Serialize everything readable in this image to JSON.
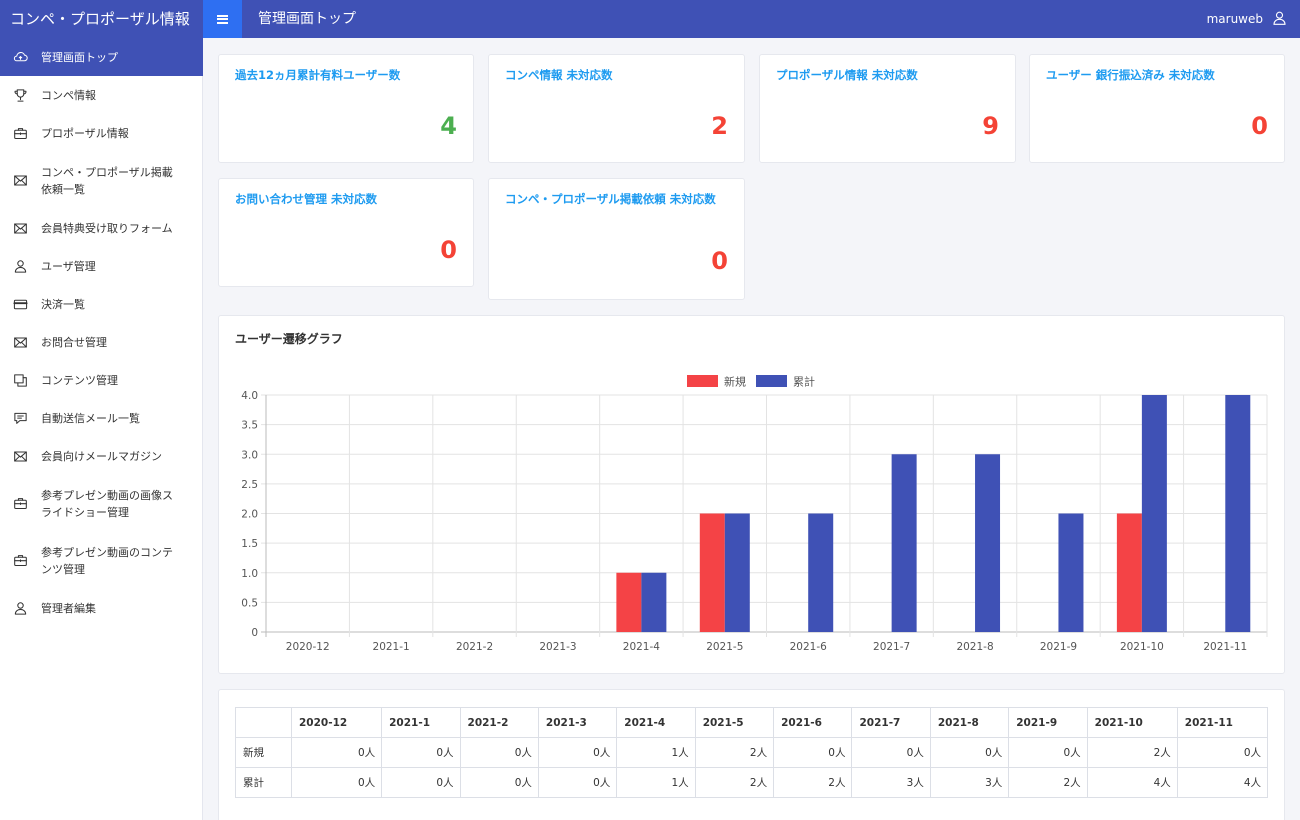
{
  "header": {
    "app_title": "コンペ・プロポーザル情報",
    "page_title": "管理画面トップ",
    "username": "maruweb"
  },
  "sidebar": {
    "items": [
      {
        "label": "管理画面トップ",
        "icon": "cloud-icon",
        "active": true
      },
      {
        "label": "コンペ情報",
        "icon": "trophy-icon"
      },
      {
        "label": "プロポーザル情報",
        "icon": "briefcase-icon"
      },
      {
        "label": "コンペ・プロポーザル掲載依頼一覧",
        "icon": "envelope-icon"
      },
      {
        "label": "会員特典受け取りフォーム",
        "icon": "envelope-icon"
      },
      {
        "label": "ユーザ管理",
        "icon": "user-icon"
      },
      {
        "label": "決済一覧",
        "icon": "credit-card-icon"
      },
      {
        "label": "お問合せ管理",
        "icon": "envelope-icon"
      },
      {
        "label": "コンテンツ管理",
        "icon": "copy-icon"
      },
      {
        "label": "自動送信メール一覧",
        "icon": "chat-icon"
      },
      {
        "label": "会員向けメールマガジン",
        "icon": "envelope-icon"
      },
      {
        "label": "参考プレゼン動画の画像スライドショー管理",
        "icon": "briefcase-icon"
      },
      {
        "label": "参考プレゼン動画のコンテンツ管理",
        "icon": "briefcase-icon"
      },
      {
        "label": "管理者編集",
        "icon": "user-icon"
      }
    ]
  },
  "stats": [
    {
      "title": "過去12ヵ月累計有料ユーザー数",
      "value": "4",
      "color": "#4caf50"
    },
    {
      "title": "コンペ情報 未対応数",
      "value": "2",
      "color": "#f44336"
    },
    {
      "title": "プロポーザル情報 未対応数",
      "value": "9",
      "color": "#f44336"
    },
    {
      "title": "ユーザー 銀行振込済み 未対応数",
      "value": "0",
      "color": "#f44336"
    },
    {
      "title": "お問い合わせ管理 未対応数",
      "value": "0",
      "color": "#f44336"
    },
    {
      "title": "コンペ・プロポーザル掲載依頼 未対応数",
      "value": "0",
      "color": "#f44336"
    }
  ],
  "chart_section": {
    "title": "ユーザー遷移グラフ"
  },
  "chart_data": {
    "type": "bar",
    "categories": [
      "2020-12",
      "2021-1",
      "2021-2",
      "2021-3",
      "2021-4",
      "2021-5",
      "2021-6",
      "2021-7",
      "2021-8",
      "2021-9",
      "2021-10",
      "2021-11"
    ],
    "series": [
      {
        "name": "新規",
        "color": "#f44346",
        "values": [
          0,
          0,
          0,
          0,
          1,
          2,
          0,
          0,
          0,
          0,
          2,
          0
        ]
      },
      {
        "name": "累計",
        "color": "#3f51b5",
        "values": [
          0,
          0,
          0,
          0,
          1,
          2,
          2,
          3,
          3,
          2,
          4,
          4
        ]
      }
    ],
    "ylim": [
      0,
      4
    ],
    "yticks": [
      "0",
      "0.5",
      "1.0",
      "1.5",
      "2.0",
      "2.5",
      "3.0",
      "3.5",
      "4.0"
    ],
    "legend": "top",
    "grid": true
  },
  "table": {
    "columns": [
      "2020-12",
      "2021-1",
      "2021-2",
      "2021-3",
      "2021-4",
      "2021-5",
      "2021-6",
      "2021-7",
      "2021-8",
      "2021-9",
      "2021-10",
      "2021-11"
    ],
    "rows": [
      {
        "label": "新規",
        "values": [
          "0人",
          "0人",
          "0人",
          "0人",
          "1人",
          "2人",
          "0人",
          "0人",
          "0人",
          "0人",
          "2人",
          "0人"
        ]
      },
      {
        "label": "累計",
        "values": [
          "0人",
          "0人",
          "0人",
          "0人",
          "1人",
          "2人",
          "2人",
          "3人",
          "3人",
          "2人",
          "4人",
          "4人"
        ]
      }
    ]
  }
}
